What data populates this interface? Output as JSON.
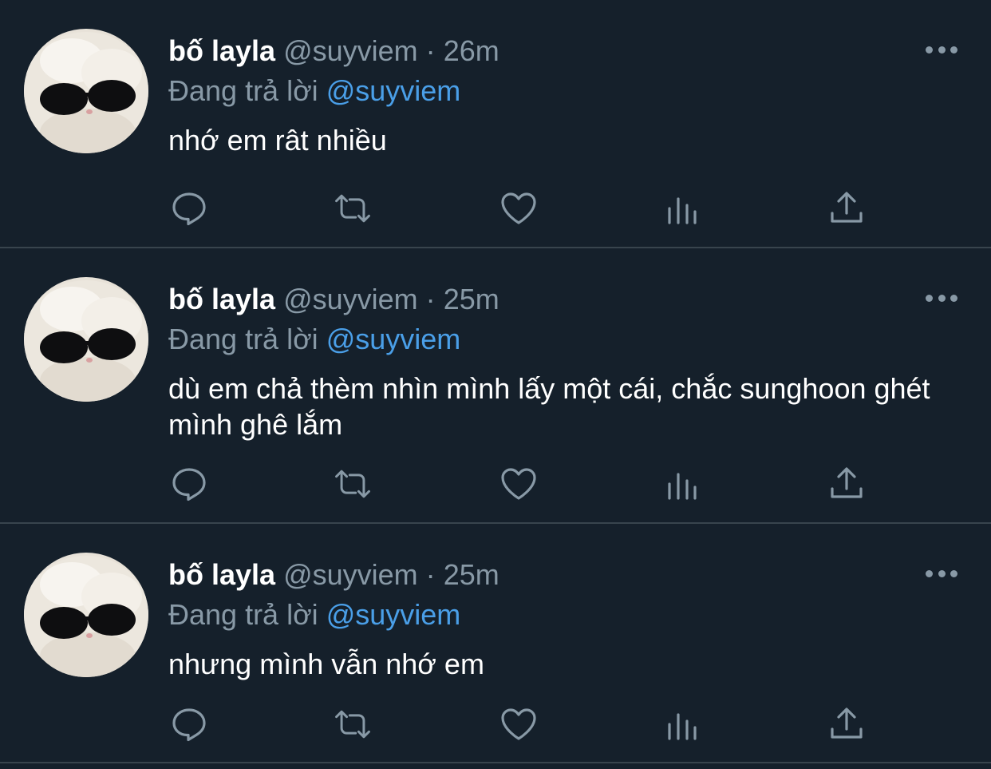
{
  "tweets": [
    {
      "name": "bố layla",
      "handle": "@suyviem",
      "separator": "·",
      "time": "26m",
      "reply_prefix": "Đang trả lời",
      "reply_to": "@suyviem",
      "text": "nhớ em rât nhiều"
    },
    {
      "name": "bố layla",
      "handle": "@suyviem",
      "separator": "·",
      "time": "25m",
      "reply_prefix": "Đang trả lời",
      "reply_to": "@suyviem",
      "text": "dù em chả thèm nhìn mình lấy một cái, chắc sunghoon ghét mình ghê lắm"
    },
    {
      "name": "bố layla",
      "handle": "@suyviem",
      "separator": "·",
      "time": "25m",
      "reply_prefix": "Đang trả lời",
      "reply_to": "@suyviem",
      "text": "nhưng mình vẫn nhớ em"
    }
  ],
  "icons": {
    "more": "more-horizontal-icon",
    "reply": "reply-icon",
    "retweet": "retweet-icon",
    "like": "heart-icon",
    "analytics": "analytics-icon",
    "share": "share-icon"
  },
  "colors": {
    "background": "#15202b",
    "divider": "#38444d",
    "secondary_text": "#8899a6",
    "mention": "#4a9fe8",
    "primary_text": "#ffffff"
  }
}
